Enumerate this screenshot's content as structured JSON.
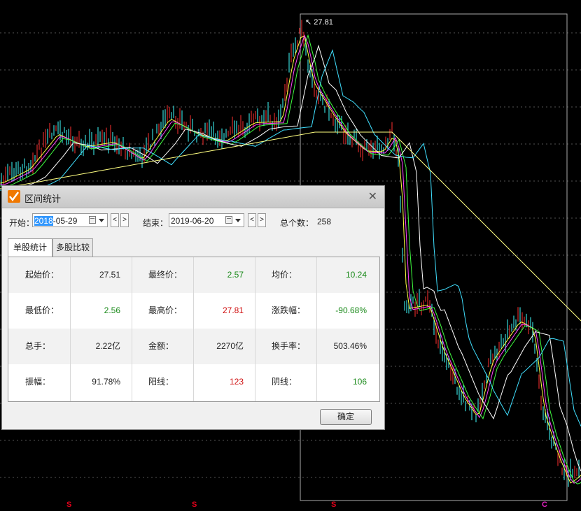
{
  "chart": {
    "peak_label": "27.81",
    "bottom_marks": [
      {
        "text": "S",
        "color": "red"
      },
      {
        "text": "S",
        "color": "red"
      },
      {
        "text": "S",
        "color": "red"
      },
      {
        "text": "C",
        "color": "magenta"
      }
    ],
    "colors": {
      "background": "#000000",
      "ma_white": "#ffffff",
      "ma_yellow": "#ffff40",
      "ma_magenta": "#ff40ff",
      "ma_green": "#40ff40",
      "ma_cyan": "#40e0ff",
      "ma_longyellow": "#ffff80",
      "up_candle": "#ff3030",
      "down_candle": "#40ffff"
    }
  },
  "dialog": {
    "title": "区间统计",
    "start_label": "开始：",
    "start_date_selected": "2018",
    "start_date_rest": "-05-29",
    "end_label": "结束：",
    "end_date": "2019-06-20",
    "prev_btn": "<",
    "next_btn": ">",
    "count_label": "总个数：",
    "count_value": "258",
    "tabs": [
      "单股统计",
      "多股比较"
    ],
    "stats": [
      [
        {
          "k": "起始价：",
          "v": "27.51",
          "c": "black"
        },
        {
          "k": "最终价：",
          "v": "2.57",
          "c": "green"
        },
        {
          "k": "均价：",
          "v": "10.24",
          "c": "green"
        }
      ],
      [
        {
          "k": "最低价：",
          "v": "2.56",
          "c": "green"
        },
        {
          "k": "最高价：",
          "v": "27.81",
          "c": "red"
        },
        {
          "k": "涨跌幅：",
          "v": "-90.68%",
          "c": "green"
        }
      ],
      [
        {
          "k": "总手：",
          "v": "2.22亿",
          "c": "black"
        },
        {
          "k": "金额：",
          "v": "2270亿",
          "c": "black"
        },
        {
          "k": "换手率：",
          "v": "503.46%",
          "c": "black"
        }
      ],
      [
        {
          "k": "振幅：",
          "v": "91.78%",
          "c": "black"
        },
        {
          "k": "阳线：",
          "v": "123",
          "c": "red"
        },
        {
          "k": "阴线：",
          "v": "106",
          "c": "green"
        }
      ]
    ],
    "ok_label": "确定"
  }
}
